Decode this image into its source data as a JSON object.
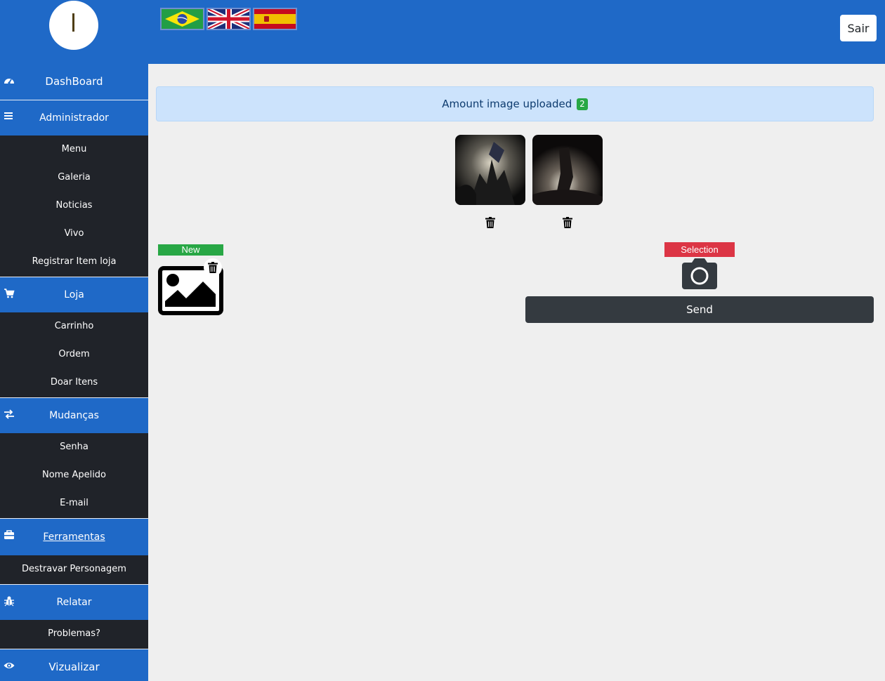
{
  "header": {
    "logo_letter": "I",
    "flags": [
      "flag-brazil-icon",
      "flag-uk-icon",
      "flag-spain-icon"
    ],
    "logout_label": "Sair"
  },
  "sidebar": {
    "dashboard": "DashBoard",
    "admin": {
      "label": "Administrador",
      "items": [
        "Menu",
        "Galeria",
        "Noticias",
        "Vivo",
        "Registrar Item loja"
      ]
    },
    "loja": {
      "label": "Loja",
      "items": [
        "Carrinho",
        "Ordem",
        "Doar Itens"
      ]
    },
    "mudancas": {
      "label": "Mudanças",
      "items": [
        "Senha",
        "Nome Apelido",
        "E-mail"
      ]
    },
    "ferramentas": {
      "label": "Ferramentas",
      "items": [
        "Destravar Personagem"
      ]
    },
    "relatar": {
      "label": "Relatar",
      "items": [
        "Problemas?"
      ]
    },
    "vizualizar": "Vizualizar"
  },
  "main": {
    "alert_text": "Amount image uploaded",
    "upload_count": "2",
    "new_label": "New",
    "selection_label": "Selection",
    "send_label": "Send"
  },
  "colors": {
    "primary": "#1f69c7",
    "sidebar_dark": "#202329",
    "success": "#28a745",
    "danger": "#dc3545",
    "button_dark": "#343a40",
    "alert_bg": "#cce3fc"
  }
}
